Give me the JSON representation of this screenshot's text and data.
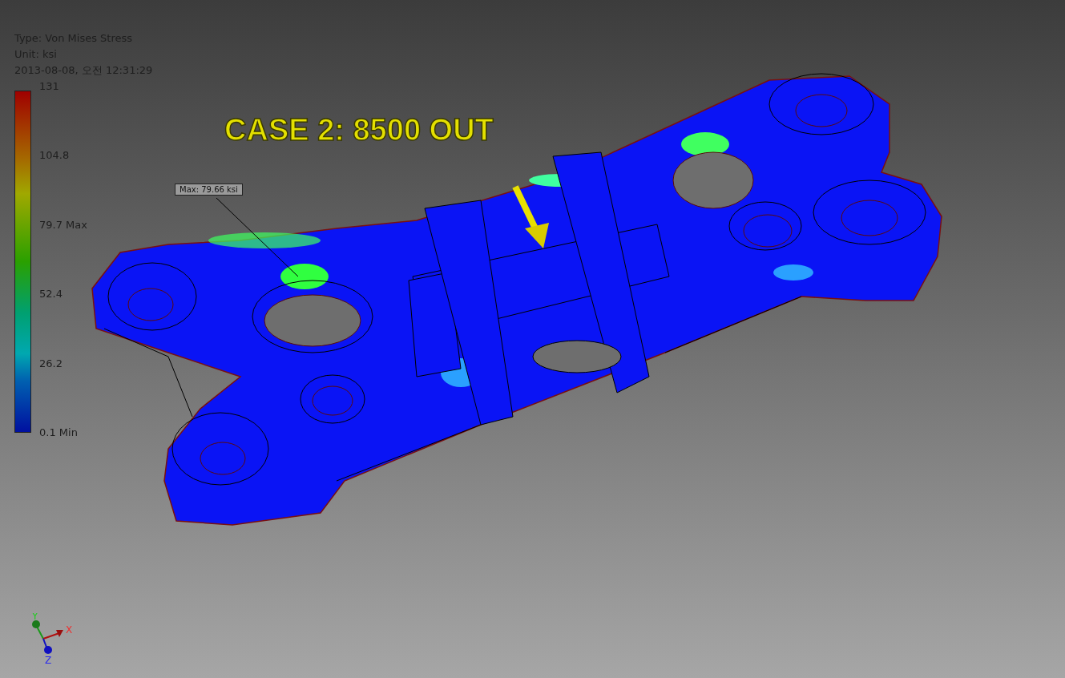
{
  "result_info": {
    "type_line": "Type: Von Mises Stress",
    "unit_line": "Unit: ksi",
    "timestamp": "2013-08-08, 오전 12:31:29"
  },
  "legend": {
    "labels": [
      "131",
      "104.8",
      "79.7 Max",
      "52.4",
      "26.2",
      "0.1 Min"
    ]
  },
  "title": "CASE 2: 8500 OUT",
  "probe": {
    "label": "Max: 79.66 ksi"
  },
  "triad": {
    "x": "X",
    "y": "Y",
    "z": "Z"
  }
}
